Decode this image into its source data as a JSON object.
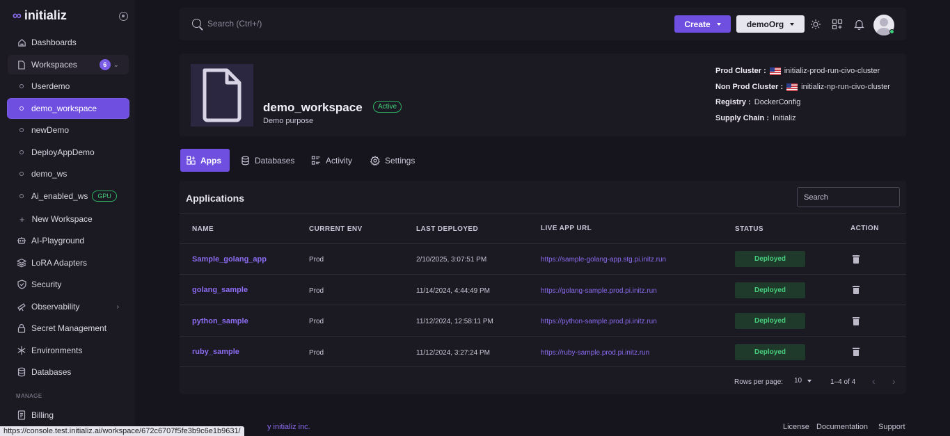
{
  "brand": {
    "name": "initializ"
  },
  "sidebar": {
    "items": [
      {
        "label": "Dashboards"
      },
      {
        "label": "Workspaces",
        "count": "6"
      },
      {
        "label": "Userdemo"
      },
      {
        "label": "demo_workspace"
      },
      {
        "label": "newDemo"
      },
      {
        "label": "DeployAppDemo"
      },
      {
        "label": "demo_ws"
      },
      {
        "label": "Ai_enabled_ws",
        "badge": "GPU"
      },
      {
        "label": "New Workspace"
      },
      {
        "label": "AI-Playground"
      },
      {
        "label": "LoRA Adapters"
      },
      {
        "label": "Security"
      },
      {
        "label": "Observability"
      },
      {
        "label": "Secret Management"
      },
      {
        "label": "Environments"
      },
      {
        "label": "Databases"
      },
      {
        "label": "Billing"
      }
    ],
    "manage_label": "MANAGE"
  },
  "topbar": {
    "search_placeholder": "Search (Ctrl+/)",
    "create_label": "Create",
    "org_label": "demoOrg"
  },
  "workspace": {
    "title": "demo_workspace",
    "status": "Active",
    "description": "Demo purpose",
    "prod_cluster_label": "Prod Cluster :",
    "prod_cluster": "initializ-prod-run-civo-cluster",
    "nonprod_cluster_label": "Non Prod Cluster :",
    "nonprod_cluster": "initializ-np-run-civo-cluster",
    "registry_label": "Registry :",
    "registry": "DockerConfig",
    "supply_chain_label": "Supply Chain :",
    "supply_chain": "Initializ"
  },
  "tabs": [
    {
      "label": "Apps"
    },
    {
      "label": "Databases"
    },
    {
      "label": "Activity"
    },
    {
      "label": "Settings"
    }
  ],
  "applications": {
    "title": "Applications",
    "search_placeholder": "Search",
    "columns": [
      "NAME",
      "CURRENT ENV",
      "LAST DEPLOYED",
      "LIVE APP URL",
      "STATUS",
      "ACTION"
    ],
    "rows": [
      {
        "name": "Sample_golang_app",
        "env": "Prod",
        "deployed": "2/10/2025, 3:07:51 PM",
        "url": "https://sample-golang-app.stg.pi.initz.run",
        "status": "Deployed"
      },
      {
        "name": "golang_sample",
        "env": "Prod",
        "deployed": "11/14/2024, 4:44:49 PM",
        "url": "https://golang-sample.prod.pi.initz.run",
        "status": "Deployed"
      },
      {
        "name": "python_sample",
        "env": "Prod",
        "deployed": "11/12/2024, 12:58:11 PM",
        "url": "https://python-sample.prod.pi.initz.run",
        "status": "Deployed"
      },
      {
        "name": "ruby_sample",
        "env": "Prod",
        "deployed": "11/12/2024, 3:27:24 PM",
        "url": "https://ruby-sample.prod.pi.initz.run",
        "status": "Deployed"
      }
    ],
    "rows_per_page_label": "Rows per page:",
    "rows_per_page": "10",
    "range": "1–4 of 4"
  },
  "footer": {
    "copyright": "y initializ inc.",
    "links": [
      "License",
      "Documentation",
      "Support"
    ]
  },
  "status_bar_url": "https://console.test.initializ.ai/workspace/672c6707f5fe3b9c6e1b9631/",
  "colors": {
    "accent": "#6f4fe0",
    "success": "#46cf7c",
    "bg": "#16141c",
    "panel": "#1b1922"
  }
}
